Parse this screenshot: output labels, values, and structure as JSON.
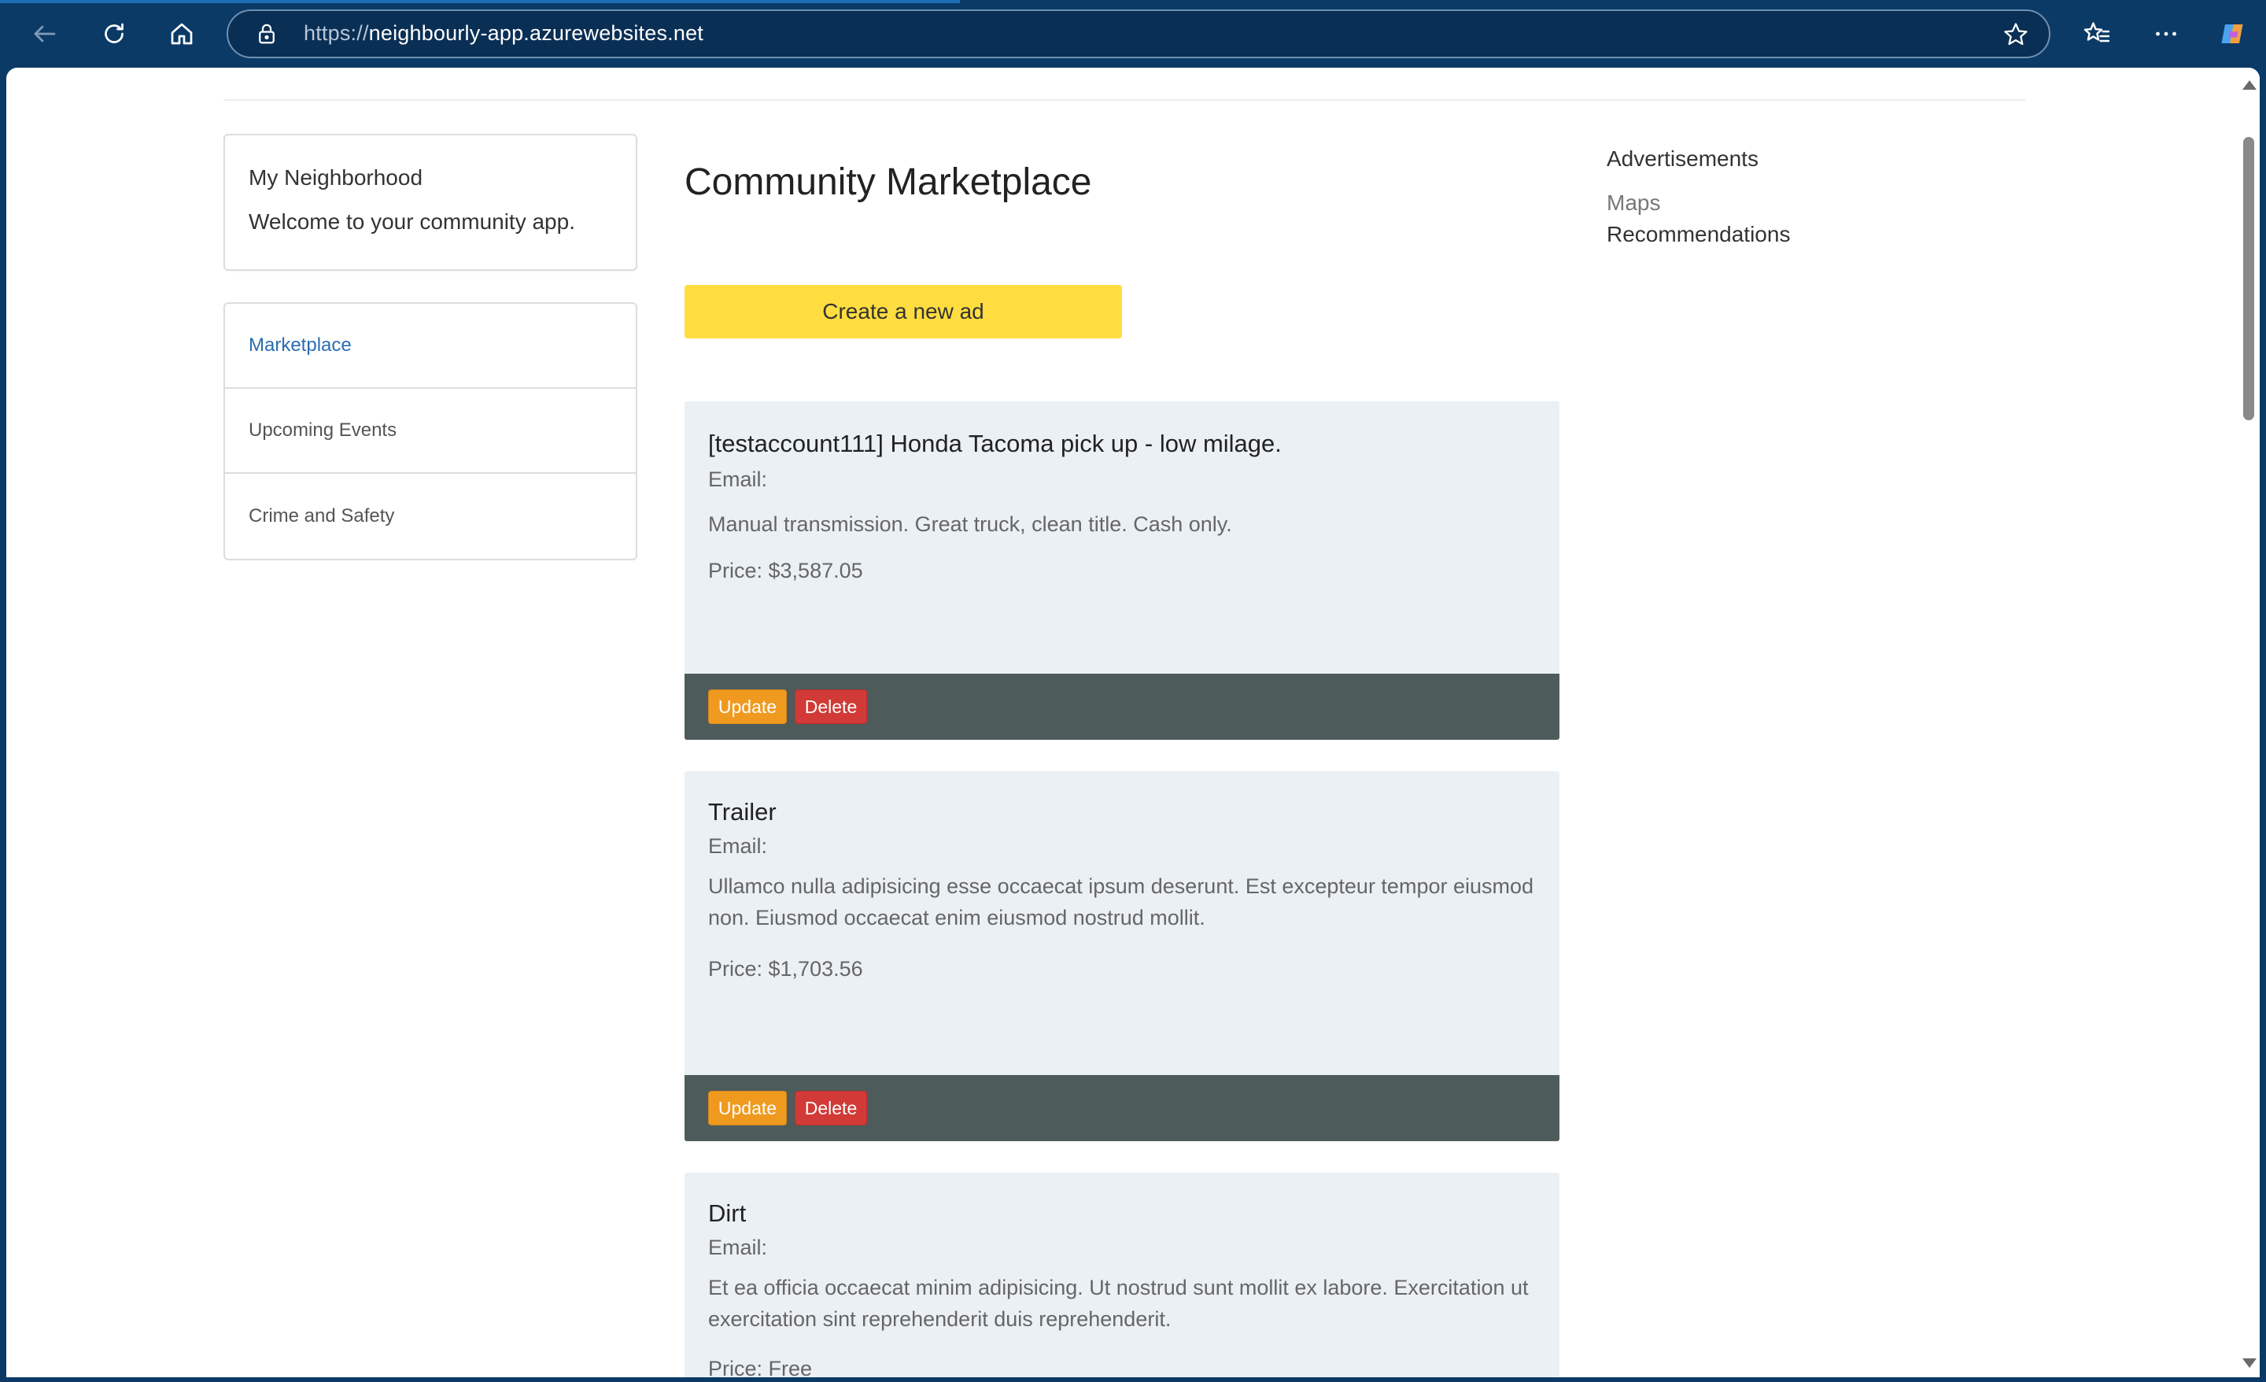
{
  "browser": {
    "url_scheme": "https://",
    "url_host": "neighbourly-app.azurewebsites.net"
  },
  "sidebar": {
    "brand_title": "My Neighborhood",
    "welcome": "Welcome to your community app.",
    "nav": [
      {
        "label": "Marketplace"
      },
      {
        "label": "Upcoming Events"
      },
      {
        "label": "Crime and Safety"
      }
    ]
  },
  "main": {
    "title": "Community Marketplace",
    "create_label": "Create a new ad",
    "ads": [
      {
        "title": "[testaccount111] Honda Tacoma pick up - low milage.",
        "email": "Email:",
        "description": "Manual transmission. Great truck, clean title. Cash only.",
        "price": "Price: $3,587.05",
        "update_label": "Update",
        "delete_label": "Delete"
      },
      {
        "title": "Trailer",
        "email": "Email:",
        "description": "Ullamco nulla adipisicing esse occaecat ipsum deserunt. Est excepteur tempor eiusmod non. Eiusmod occaecat enim eiusmod nostrud mollit.",
        "price": "Price: $1,703.56",
        "update_label": "Update",
        "delete_label": "Delete"
      },
      {
        "title": "Dirt",
        "email": "Email:",
        "description": "Et ea officia occaecat minim adipisicing. Ut nostrud sunt mollit ex labore. Exercitation ut exercitation sint reprehenderit duis reprehenderit.",
        "price": "Price: Free"
      }
    ]
  },
  "right": {
    "heading": "Advertisements",
    "links": [
      {
        "label": "Maps"
      },
      {
        "label": "Recommendations"
      }
    ]
  },
  "colors": {
    "chrome": "#0b3a66",
    "create_button": "#ffdd40",
    "update_button": "#ef9a1f",
    "delete_button": "#d13a36",
    "card_bg": "#eaf0f4",
    "card_footer": "#4d5b5b",
    "active_link": "#2a6db0"
  }
}
